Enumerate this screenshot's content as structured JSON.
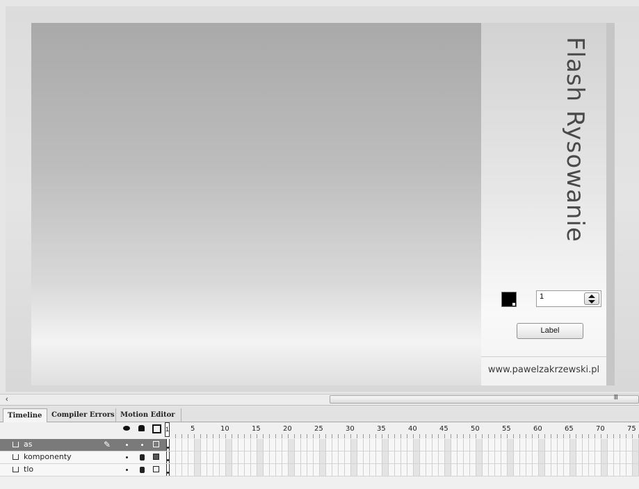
{
  "stage": {
    "title": "Flash Rysowanie",
    "stepper_value": "1",
    "button_label": "Label",
    "website": "www.pawelzakrzewski.pl",
    "swatch_color": "#000000"
  },
  "scrollbar": {
    "left_arrow": "‹",
    "grip": "III"
  },
  "timeline": {
    "tabs": [
      {
        "label": "Timeline"
      },
      {
        "label": "Compiler Errors"
      },
      {
        "label": "Motion Editor"
      }
    ],
    "current_frame": "1",
    "frame_numbers": [
      "5",
      "10",
      "15",
      "20",
      "25",
      "30",
      "35",
      "40",
      "45",
      "50",
      "55",
      "60",
      "65",
      "70",
      "75"
    ],
    "layers": [
      {
        "name": "as",
        "selected": true
      },
      {
        "name": "komponenty",
        "selected": false
      },
      {
        "name": "tlo",
        "selected": false
      }
    ]
  }
}
